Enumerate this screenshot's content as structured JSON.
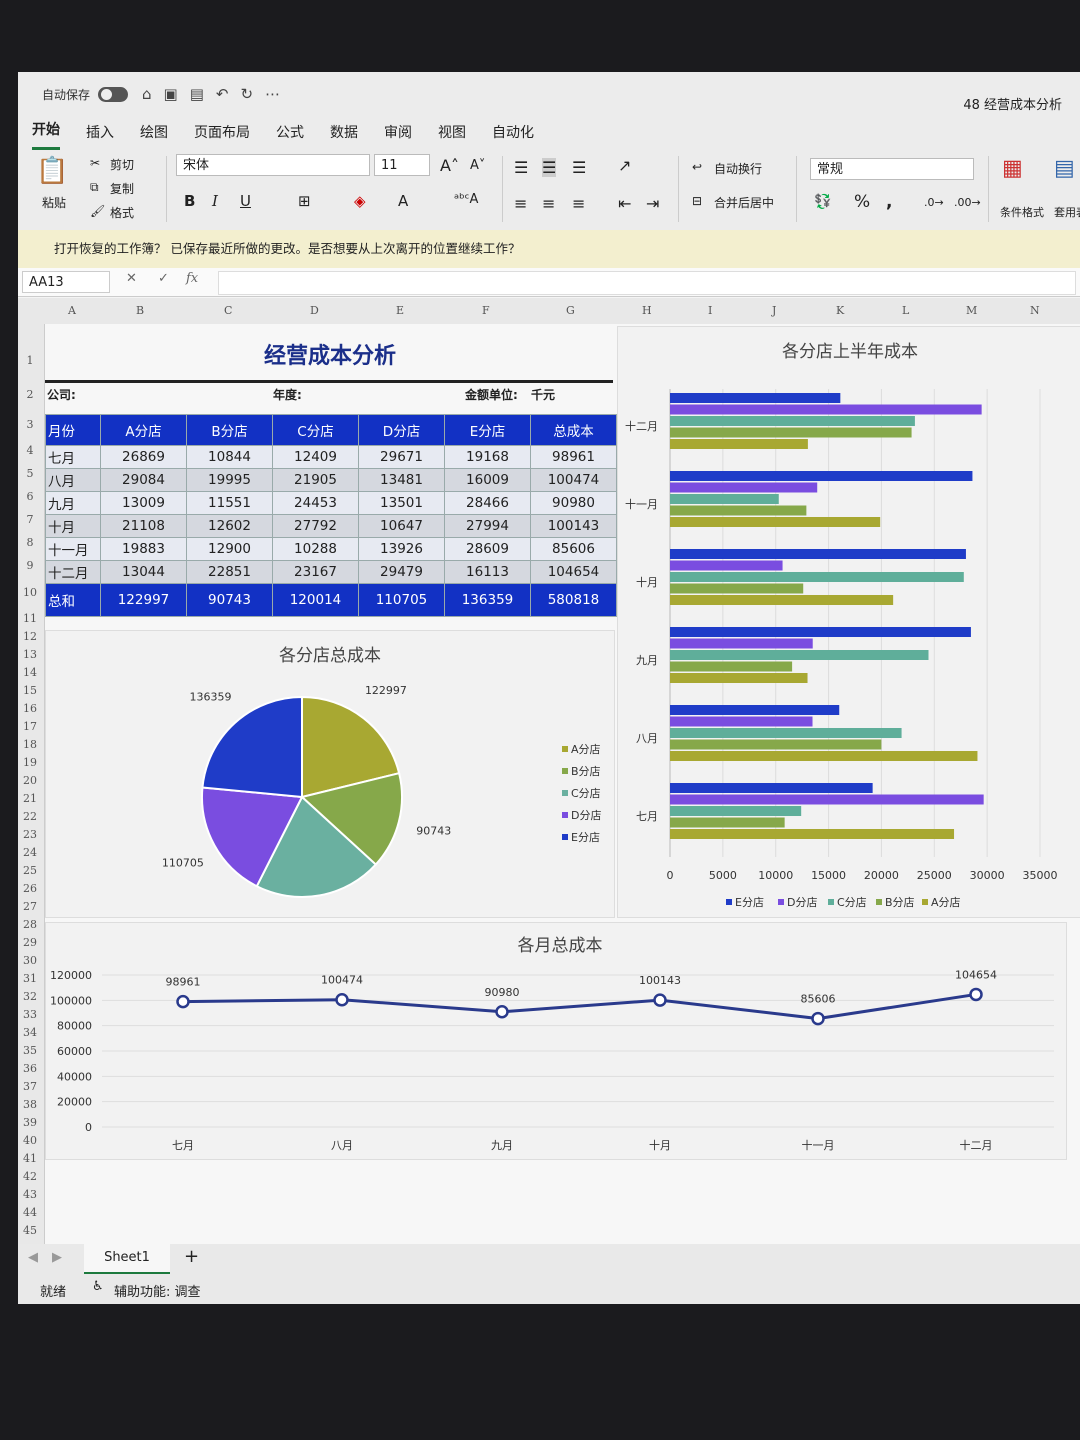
{
  "titlebar": {
    "autosave": "自动保存",
    "doc_title": "48 经营成本分析"
  },
  "menu": [
    "开始",
    "插入",
    "绘图",
    "页面布局",
    "公式",
    "数据",
    "审阅",
    "视图",
    "自动化"
  ],
  "ribbon": {
    "paste": "粘贴",
    "cut": "剪切",
    "copy": "复制",
    "format_painter": "格式",
    "font": "宋体",
    "size": "11",
    "wrap": "自动换行",
    "merge": "合并后居中",
    "number_format": "常规",
    "cond_format": "条件格式",
    "table_format": "套用表格"
  },
  "notice": "打开恢复的工作簿？ 已保存最近所做的更改。是否想要从上次离开的位置继续工作？",
  "formula": {
    "cell": "AA13",
    "fx": "fx"
  },
  "columns": [
    "A",
    "B",
    "C",
    "D",
    "E",
    "F",
    "G",
    "H",
    "I",
    "J",
    "K",
    "L",
    "M",
    "N"
  ],
  "rows": [
    "1",
    "2",
    "3",
    "4",
    "5",
    "6",
    "7",
    "8",
    "9",
    "10",
    "11",
    "12",
    "13",
    "14",
    "15",
    "16",
    "17",
    "18",
    "19",
    "20",
    "21",
    "22",
    "23",
    "24",
    "25",
    "26",
    "27",
    "28",
    "29",
    "30",
    "31",
    "32",
    "33",
    "34",
    "35",
    "36",
    "37",
    "38",
    "39",
    "40",
    "41",
    "42",
    "43",
    "44",
    "45"
  ],
  "sheet": {
    "title": "经营成本分析",
    "company_label": "公司:",
    "year_label": "年度:",
    "unit_label": "金额单位:",
    "unit_value": "千元",
    "headers": [
      "月份",
      "A分店",
      "B分店",
      "C分店",
      "D分店",
      "E分店",
      "总成本"
    ],
    "rows": [
      [
        "七月",
        "26869",
        "10844",
        "12409",
        "29671",
        "19168",
        "98961"
      ],
      [
        "八月",
        "29084",
        "19995",
        "21905",
        "13481",
        "16009",
        "100474"
      ],
      [
        "九月",
        "13009",
        "11551",
        "24453",
        "13501",
        "28466",
        "90980"
      ],
      [
        "十月",
        "21108",
        "12602",
        "27792",
        "10647",
        "27994",
        "100143"
      ],
      [
        "十一月",
        "19883",
        "12900",
        "10288",
        "13926",
        "28609",
        "85606"
      ],
      [
        "十二月",
        "13044",
        "22851",
        "23167",
        "29479",
        "16113",
        "104654"
      ]
    ],
    "total": [
      "总和",
      "122997",
      "90743",
      "120014",
      "110705",
      "136359",
      "580818"
    ]
  },
  "chart_data": [
    {
      "type": "pie",
      "title": "各分店总成本",
      "categories": [
        "A分店",
        "B分店",
        "C分店",
        "D分店",
        "E分店"
      ],
      "values": [
        122997,
        90743,
        120014,
        110705,
        136359
      ],
      "colors": [
        "#a8a832",
        "#86a84a",
        "#6ab0a0",
        "#7a4de0",
        "#1f3cc8"
      ],
      "legend": "right"
    },
    {
      "type": "bar",
      "orientation": "horizontal",
      "title": "各分店上半年成本",
      "categories": [
        "七月",
        "八月",
        "九月",
        "十月",
        "十一月",
        "十二月"
      ],
      "series": [
        {
          "name": "A分店",
          "values": [
            26869,
            29084,
            13009,
            21108,
            19883,
            13044
          ],
          "color": "#a8a832"
        },
        {
          "name": "B分店",
          "values": [
            10844,
            19995,
            11551,
            12602,
            12900,
            22851
          ],
          "color": "#86a84a"
        },
        {
          "name": "C分店",
          "values": [
            12409,
            21905,
            24453,
            27792,
            10288,
            23167
          ],
          "color": "#5fae9a"
        },
        {
          "name": "D分店",
          "values": [
            29671,
            13481,
            13501,
            10647,
            13926,
            29479
          ],
          "color": "#7a4de0"
        },
        {
          "name": "E分店",
          "values": [
            19168,
            16009,
            28466,
            27994,
            28609,
            16113
          ],
          "color": "#1f3cc8"
        }
      ],
      "xlim": [
        0,
        35000
      ],
      "xticks": [
        "0",
        "5000",
        "10000",
        "15000",
        "20000",
        "25000",
        "30000",
        "35000"
      ],
      "legend": "bottom",
      "legend_order": [
        "E分店",
        "D分店",
        "C分店",
        "B分店",
        "A分店"
      ]
    },
    {
      "type": "line",
      "title": "各月总成本",
      "categories": [
        "七月",
        "八月",
        "九月",
        "十月",
        "十一月",
        "十二月"
      ],
      "values": [
        98961,
        100474,
        90980,
        100143,
        85606,
        104654
      ],
      "ylim": [
        0,
        120000
      ],
      "yticks": [
        "0",
        "20000",
        "40000",
        "60000",
        "80000",
        "100000",
        "120000"
      ],
      "color": "#2a3a8c"
    }
  ],
  "tabs": {
    "sheet": "Sheet1",
    "add": "+"
  },
  "status": {
    "ready": "就绪",
    "accessibility": "辅助功能: 调查"
  }
}
